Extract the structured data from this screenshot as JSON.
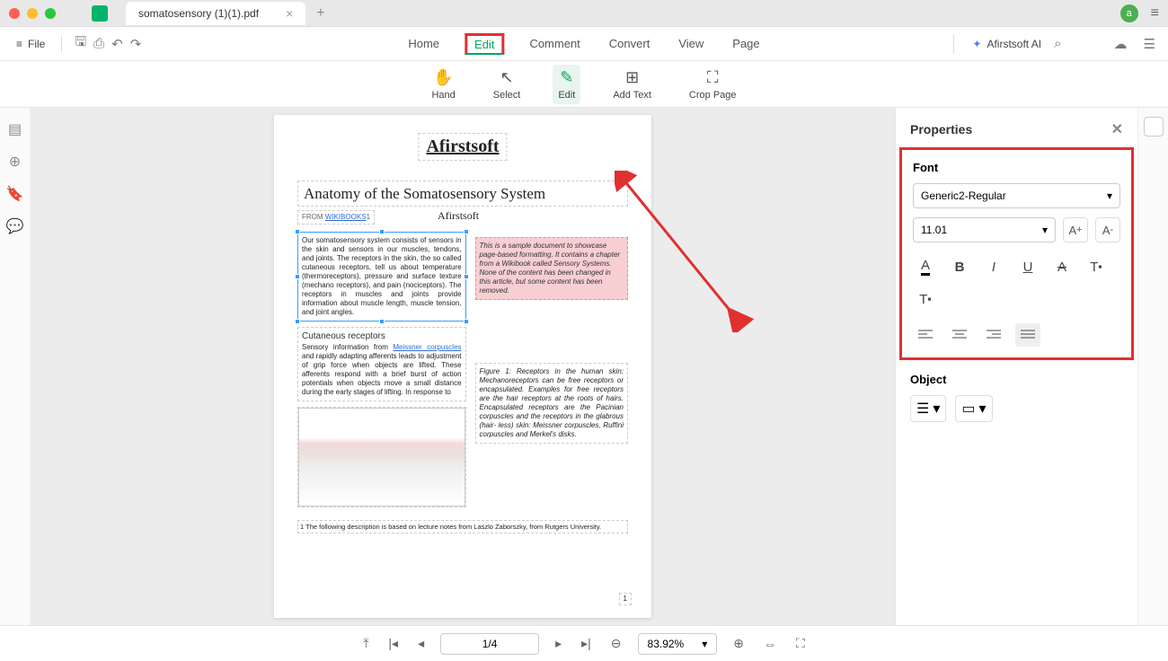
{
  "titlebar": {
    "tab_name": "somatosensory (1)(1).pdf",
    "avatar_letter": "a"
  },
  "menubar": {
    "file": "File",
    "items": [
      "Home",
      "Edit",
      "Comment",
      "Convert",
      "View",
      "Page"
    ],
    "active_index": 1,
    "ai": "Afirstsoft AI"
  },
  "toolbar": {
    "hand": "Hand",
    "select": "Select",
    "edit": "Edit",
    "add_text": "Add Text",
    "crop_page": "Crop Page",
    "active": "edit"
  },
  "document": {
    "logo": "Afirstsoft",
    "title": "Anatomy of the Somatosensory System",
    "from_label": "FROM ",
    "from_link": "WIKIBOOKS",
    "from_suffix": "1",
    "second_logo": "Afirstsoft",
    "selected_text": "Our somatosensory system consists of sensors in the skin and sensors in our muscles, tendons, and joints. The receptors in the skin, the so called cutaneous receptors, tell us about temperature (thermoreceptors), pressure and surface texture (mechano receptors), and pain (nociceptors). The receptors in muscles and joints provide information about muscle length, muscle tension, and joint angles.",
    "sample_note": "This is a sample document to showcase page-based formatting. It contains a chapter from a Wikibook called Sensory Systems. None of the content has been changed in this article, but some content has been removed.",
    "subhead": "Cutaneous receptors",
    "body1_pre": "Sensory information from ",
    "body1_link": "Meissner corpuscles",
    "body1_post": " and rapidly adapting afferents leads to adjustment of grip force when objects are lifted. These afferents respond with a brief burst of action potentials when objects move a small distance during the early stages of lifting. In response to",
    "figure_caption": "Figure 1: Receptors in the human skin: Mechanoreceptors can be free receptors or encapsulated. Examples for free receptors are the hair receptors at the roots of hairs. Encapsulated receptors are the Pacinian corpuscles and the receptors in the glabrous (hair- less) skin: Meissner corpuscles, Ruffini corpuscles and Merkel's disks.",
    "footnote": "1 The following description is based on lecture notes from Laszlo Zaborszky, from Rutgers University.",
    "page_number": "1"
  },
  "properties": {
    "title": "Properties",
    "font_title": "Font",
    "font_family": "Generic2-Regular",
    "font_size": "11.01",
    "object_title": "Object"
  },
  "statusbar": {
    "page": "1/4",
    "zoom": "83.92%"
  }
}
